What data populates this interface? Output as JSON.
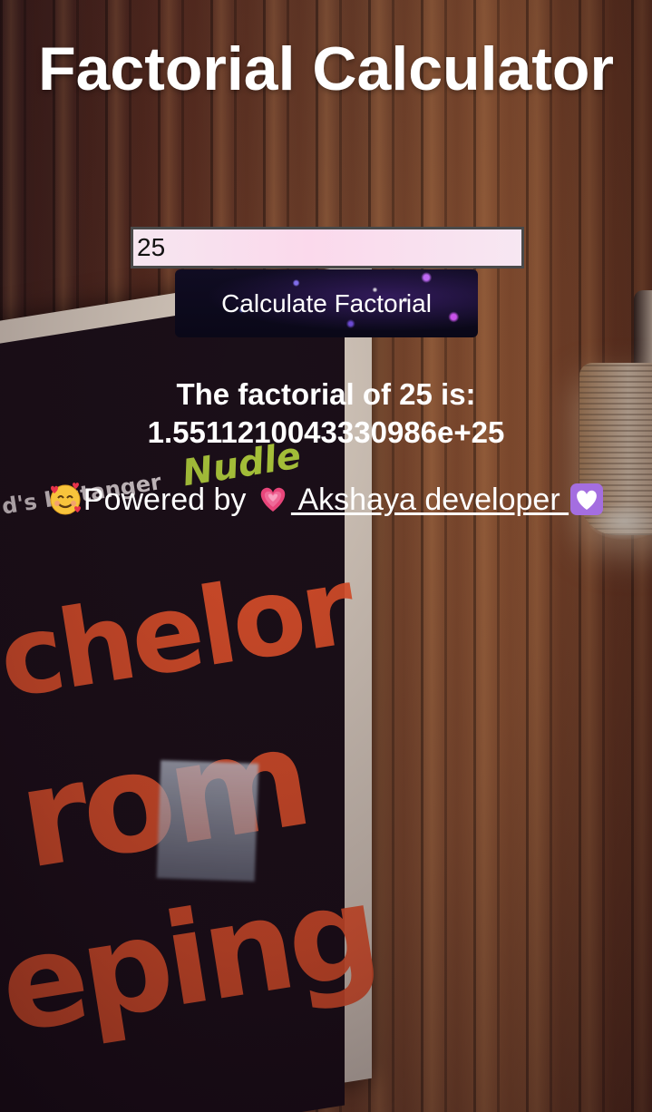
{
  "header": {
    "title": "Factorial Calculator"
  },
  "form": {
    "input_value": "25",
    "button_label": "Calculate Factorial"
  },
  "result": {
    "line1": "The factorial of 25 is:",
    "line2": "1.5511210043330986e+25"
  },
  "footer": {
    "powered_text": "Powered by ",
    "link_text": " Akshaya developer ",
    "leading_emoji": "smiling-face-with-hearts-icon",
    "heart_emoji": "growing-heart-icon",
    "trailing_emoji": "white-heart-icon"
  },
  "colors": {
    "text": "#ffffff",
    "input_bg": "#fbd9ec",
    "input_border": "#4a4a4a",
    "button_bg": "#0a0818"
  }
}
